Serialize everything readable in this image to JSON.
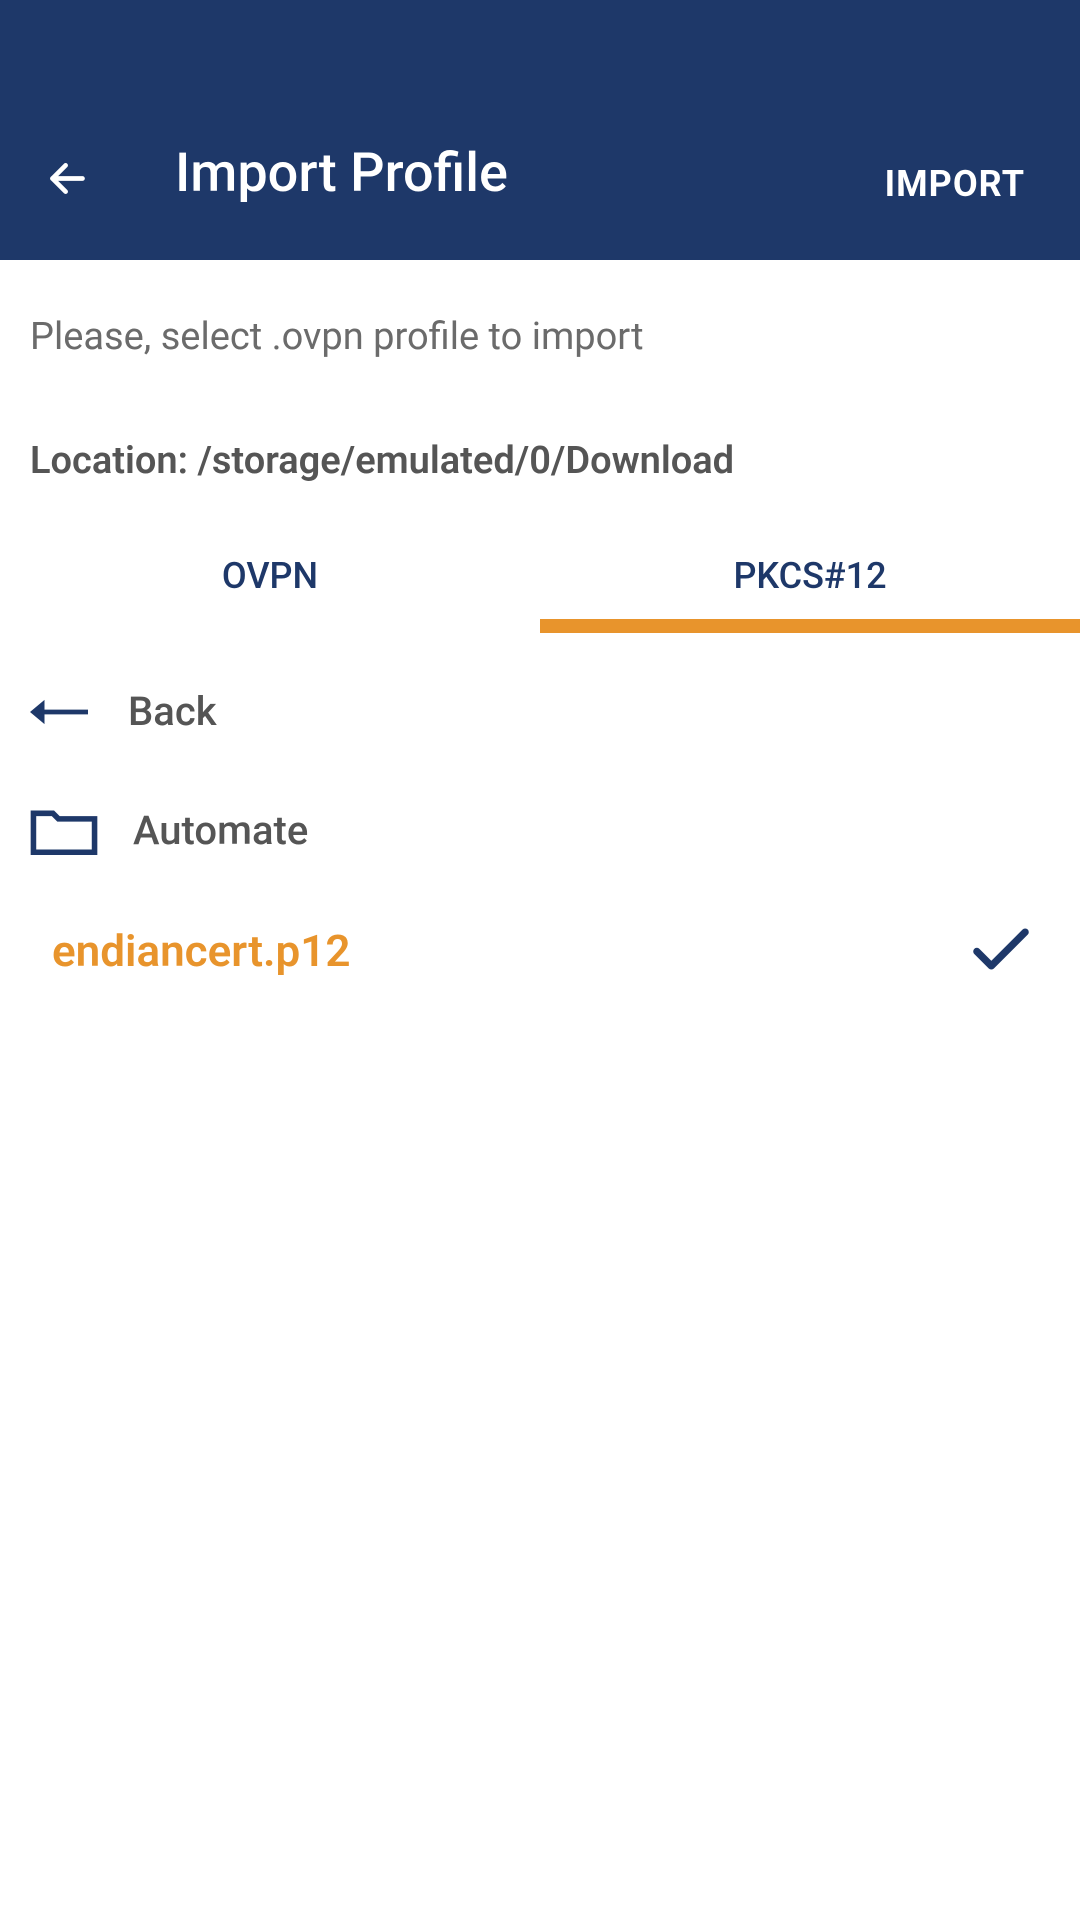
{
  "header": {
    "title": "Import Profile",
    "action": "IMPORT"
  },
  "instruction": "Please, select .ovpn profile to import",
  "location_label": "Location: /storage/emulated/0/Download",
  "tabs": {
    "ovpn": "OVPN",
    "pkcs12": "PKCS#12"
  },
  "file_browser": {
    "back_label": "Back",
    "folder_name": "Automate",
    "selected_file": "endiancert.p12"
  },
  "colors": {
    "header_bg": "#1e3869",
    "accent": "#E8942C",
    "text_muted": "#6b6b6b",
    "text_dark": "#555555"
  }
}
